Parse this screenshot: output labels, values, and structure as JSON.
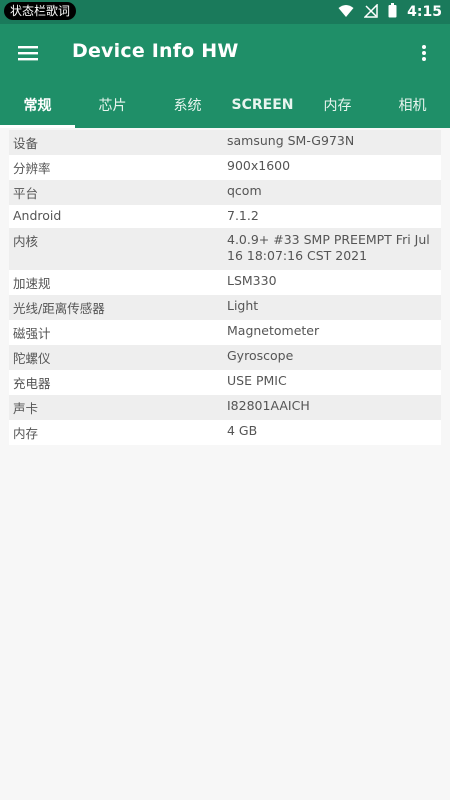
{
  "status_bar": {
    "chip_text": "状态栏歌词",
    "time": "4:15"
  },
  "app_bar": {
    "title": "Device Info HW",
    "menu_icon": "hamburger-menu-icon",
    "overflow_icon": "overflow-menu-icon"
  },
  "tabs": [
    {
      "label": "常规"
    },
    {
      "label": "芯片"
    },
    {
      "label": "系统"
    },
    {
      "label": "SCREEN"
    },
    {
      "label": "内存"
    },
    {
      "label": "相机"
    }
  ],
  "colors": {
    "status_bar": "#1a7a5b",
    "app_bar": "#1f8f68",
    "row_alt": "#eeeeee"
  },
  "rows": [
    {
      "key": "设备",
      "value": "samsung SM-G973N"
    },
    {
      "key": "分辨率",
      "value": "900x1600"
    },
    {
      "key": "平台",
      "value": "qcom"
    },
    {
      "key": "Android",
      "value": "7.1.2"
    },
    {
      "key": "内核",
      "value": "4.0.9+ #33 SMP PREEMPT Fri Jul 16 18:07:16 CST 2021"
    },
    {
      "key": "加速规",
      "value": "LSM330"
    },
    {
      "key": "光线/距离传感器",
      "value": "Light"
    },
    {
      "key": "磁强计",
      "value": "Magnetometer"
    },
    {
      "key": "陀螺仪",
      "value": "Gyroscope"
    },
    {
      "key": "充电器",
      "value": "USE PMIC"
    },
    {
      "key": "声卡",
      "value": "I82801AAICH"
    },
    {
      "key": "内存",
      "value": "4 GB"
    }
  ]
}
